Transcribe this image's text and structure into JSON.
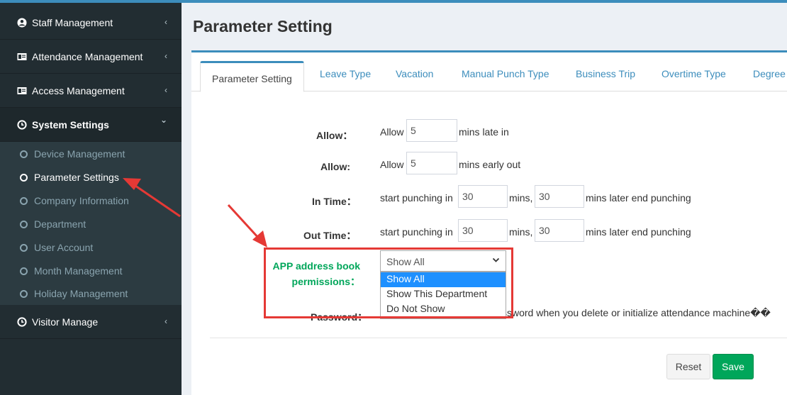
{
  "sidebar": {
    "menu": [
      {
        "label": "Staff Management",
        "icon": "user-circle-icon"
      },
      {
        "label": "Attendance Management",
        "icon": "id-card-icon"
      },
      {
        "label": "Access Management",
        "icon": "id-card-icon"
      },
      {
        "label": "System Settings",
        "icon": "clock-icon"
      },
      {
        "label": "Visitor Manage",
        "icon": "clock-icon"
      }
    ],
    "submenu": [
      {
        "label": "Device Management"
      },
      {
        "label": "Parameter Settings"
      },
      {
        "label": "Company Information"
      },
      {
        "label": "Department"
      },
      {
        "label": "User Account"
      },
      {
        "label": "Month Management"
      },
      {
        "label": "Holiday Management"
      }
    ],
    "chevron_closed": "‹",
    "chevron_open": "⌄"
  },
  "page": {
    "title": "Parameter Setting"
  },
  "tabs": [
    {
      "label": "Parameter Setting"
    },
    {
      "label": "Leave Type"
    },
    {
      "label": "Vacation"
    },
    {
      "label": "Manual Punch Type"
    },
    {
      "label": "Business Trip"
    },
    {
      "label": "Overtime Type"
    },
    {
      "label": "Degree"
    }
  ],
  "form": {
    "late": {
      "label": "Allow：",
      "prefix": "Allow",
      "value": "5",
      "suffix": "mins late in"
    },
    "early": {
      "label": "Allow:",
      "prefix": "Allow",
      "value": "5",
      "suffix": "mins early out"
    },
    "in_time": {
      "label": "In Time：",
      "prefix": "start punching in",
      "value1": "30",
      "mid": "mins,",
      "value2": "30",
      "suffix": "mins later end punching"
    },
    "out_time": {
      "label": "Out Time：",
      "prefix": "start punching in",
      "value1": "30",
      "mid": "mins,",
      "value2": "30",
      "suffix": "mins later end punching"
    },
    "app_perm": {
      "label_line1": "APP address book",
      "label_line2": "permissions：",
      "selected": "Show All",
      "options": [
        "Show All",
        "Show This Department",
        "Do Not Show"
      ]
    },
    "password": {
      "label": "Password：",
      "hint": "ssword when you delete or initialize attendance machine��"
    }
  },
  "buttons": {
    "reset": "Reset",
    "save": "Save"
  },
  "colors": {
    "sidebar_bg": "#222d32",
    "primary": "#3c8dbc",
    "save_green": "#00a65a",
    "annotation_red": "#e53935",
    "highlight_green": "#00a65a"
  }
}
